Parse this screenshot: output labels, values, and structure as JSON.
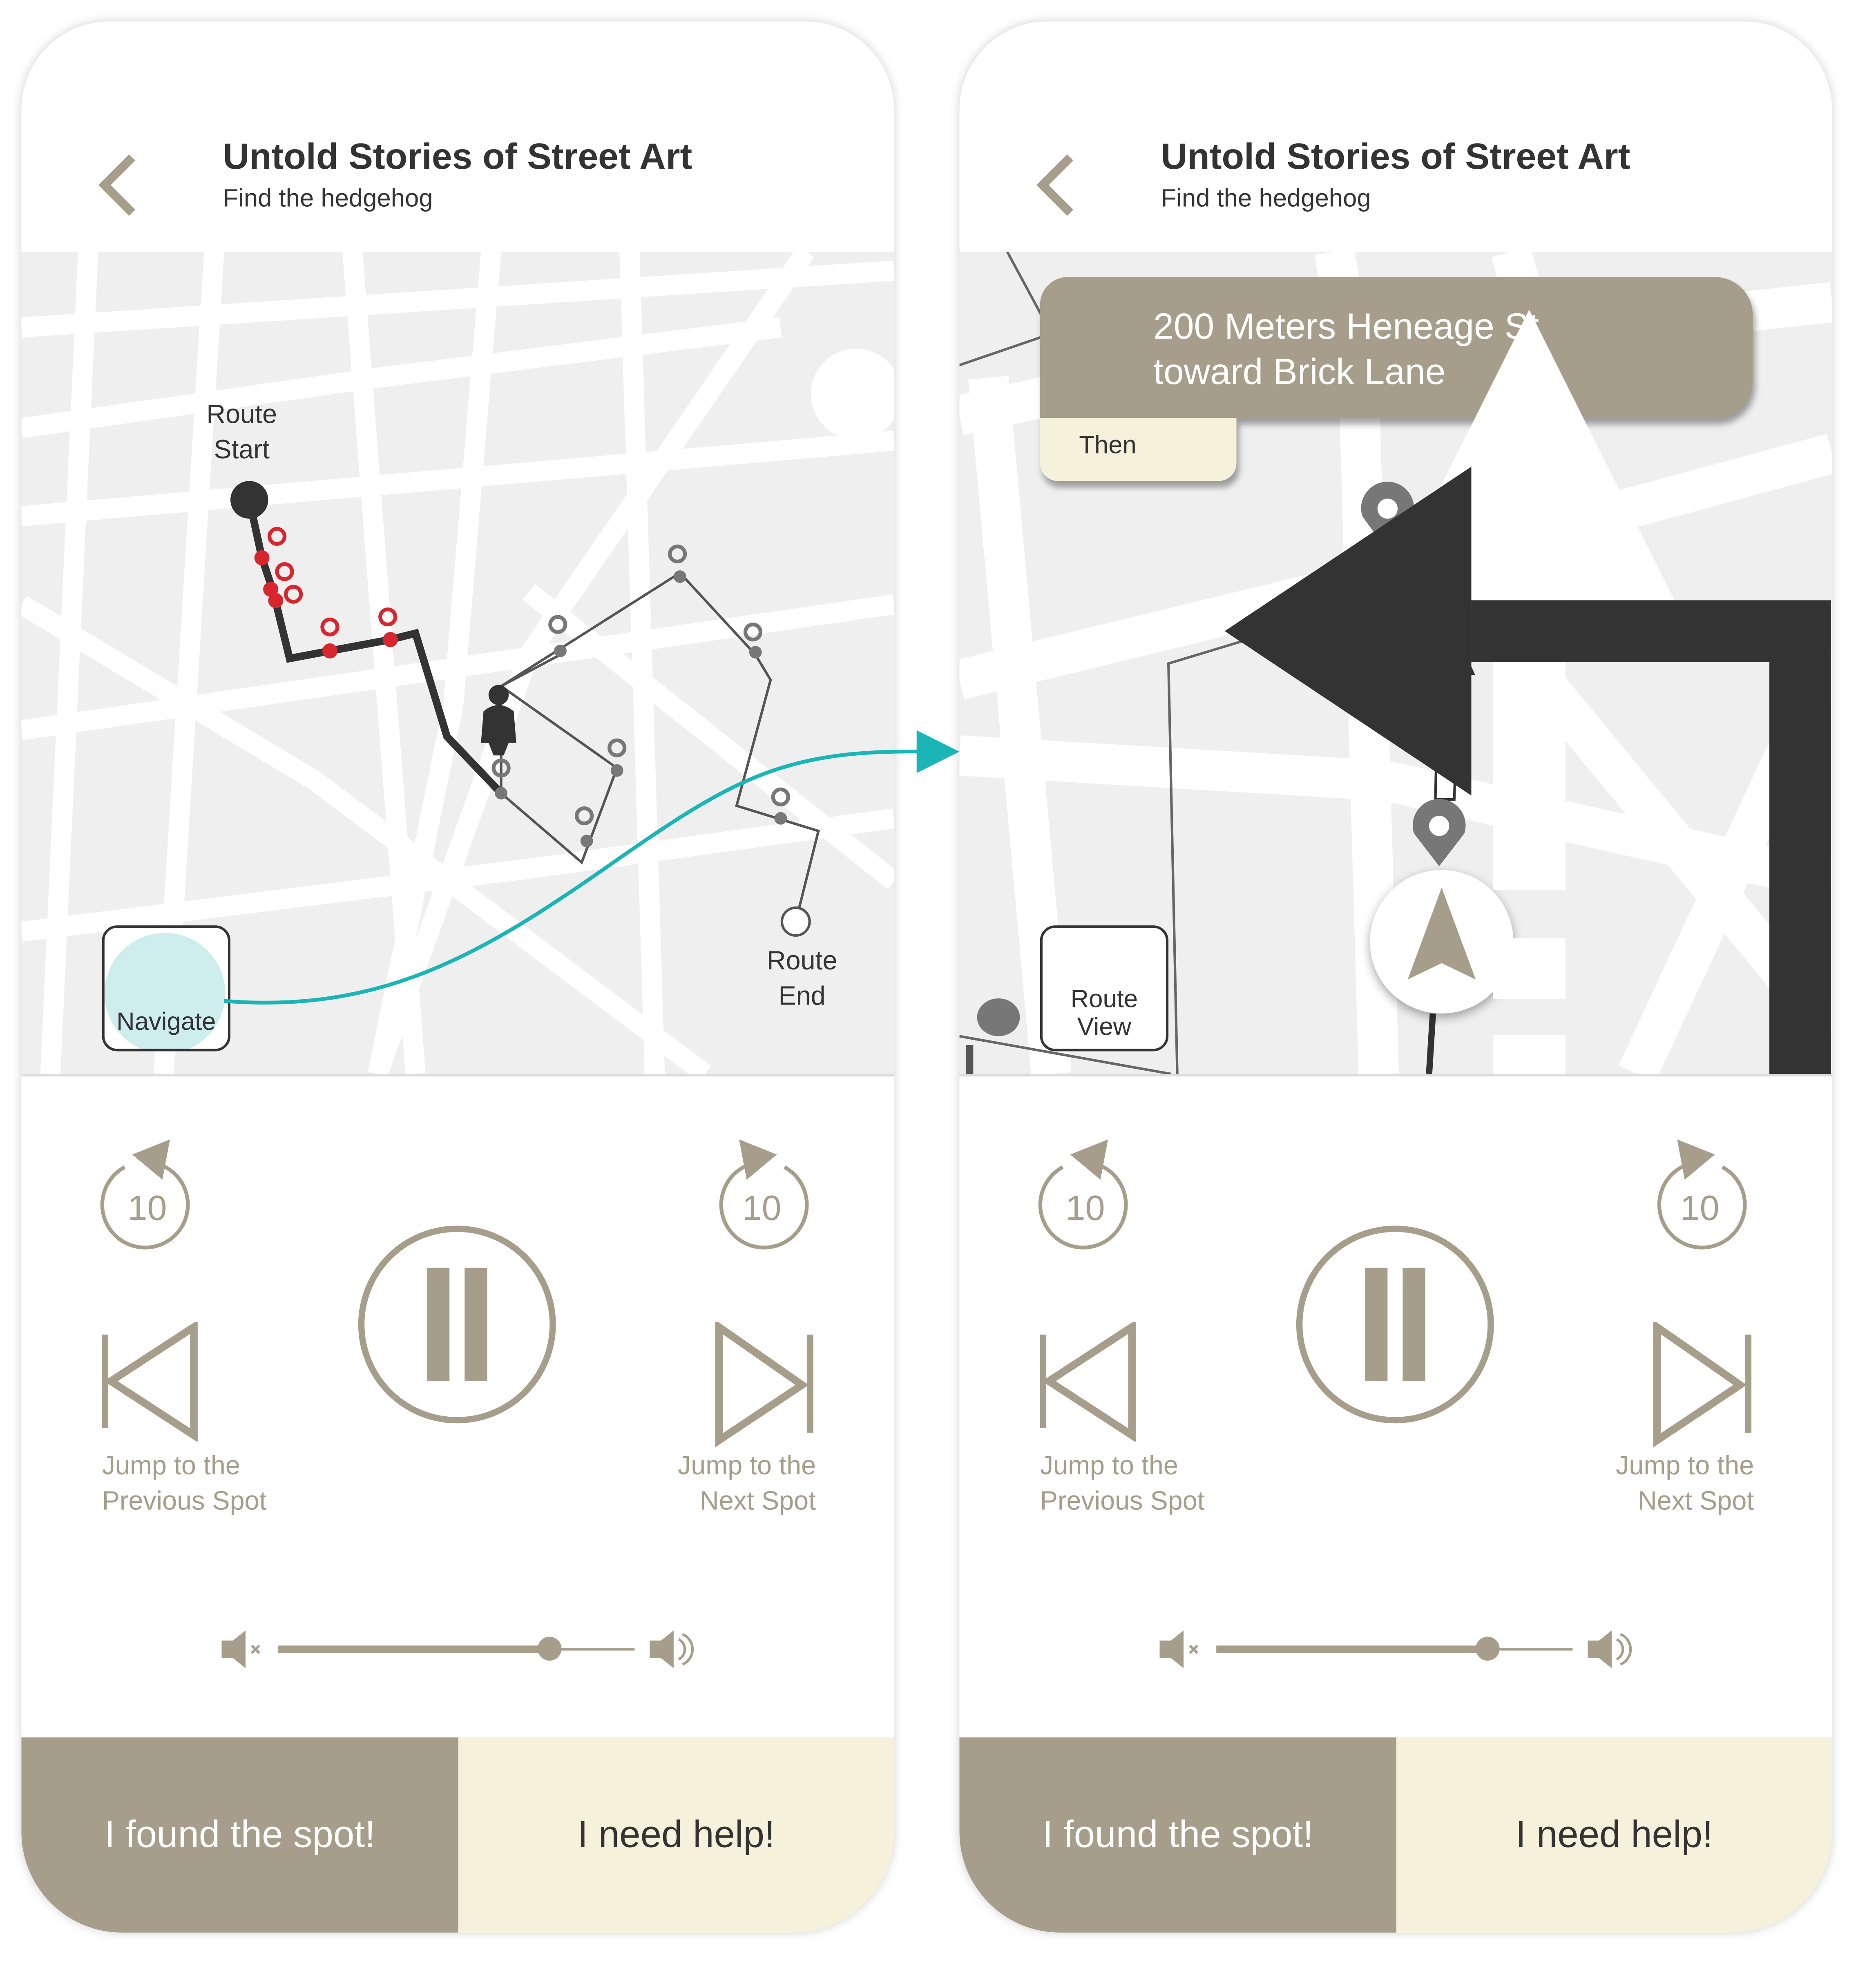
{
  "colors": {
    "accent": "#a69e8a",
    "cream": "#f6f1da",
    "teal": "#1bb5b5",
    "route_red": "#d7262e",
    "map_bg": "#efefef"
  },
  "screens": [
    {
      "header": {
        "title": "Untold Stories of Street Art",
        "subtitle": "Find the hedgehog",
        "back_icon": "chevron-left-icon"
      },
      "map": {
        "route_start": "Route\nStart",
        "route_end": "Route\nEnd",
        "mode_button": {
          "label": "Navigate",
          "icon": "turn-right-arrow-icon"
        }
      },
      "player": {
        "rewind_seconds": "10",
        "forward_seconds": "10",
        "state": "playing",
        "prev_label": "Jump to the\nPrevious Spot",
        "next_label": "Jump to the\nNext Spot",
        "volume_percent": 76
      },
      "actions": {
        "found": "I found the spot!",
        "help": "I need help!"
      }
    },
    {
      "header": {
        "title": "Untold Stories of Street Art",
        "subtitle": "Find the hedgehog",
        "back_icon": "chevron-left-icon"
      },
      "map": {
        "instruction_line1": "200 Meters Heneage St",
        "instruction_line2": "toward Brick Lane",
        "then_label": "Then",
        "then_icon": "turn-left-icon",
        "mode_button": {
          "label": "Route\nView",
          "icon": "route-pins-icon"
        }
      },
      "player": {
        "rewind_seconds": "10",
        "forward_seconds": "10",
        "state": "playing",
        "prev_label": "Jump to the\nPrevious Spot",
        "next_label": "Jump to the\nNext Spot",
        "volume_percent": 76
      },
      "actions": {
        "found": "I found the spot!",
        "help": "I need help!"
      }
    }
  ]
}
